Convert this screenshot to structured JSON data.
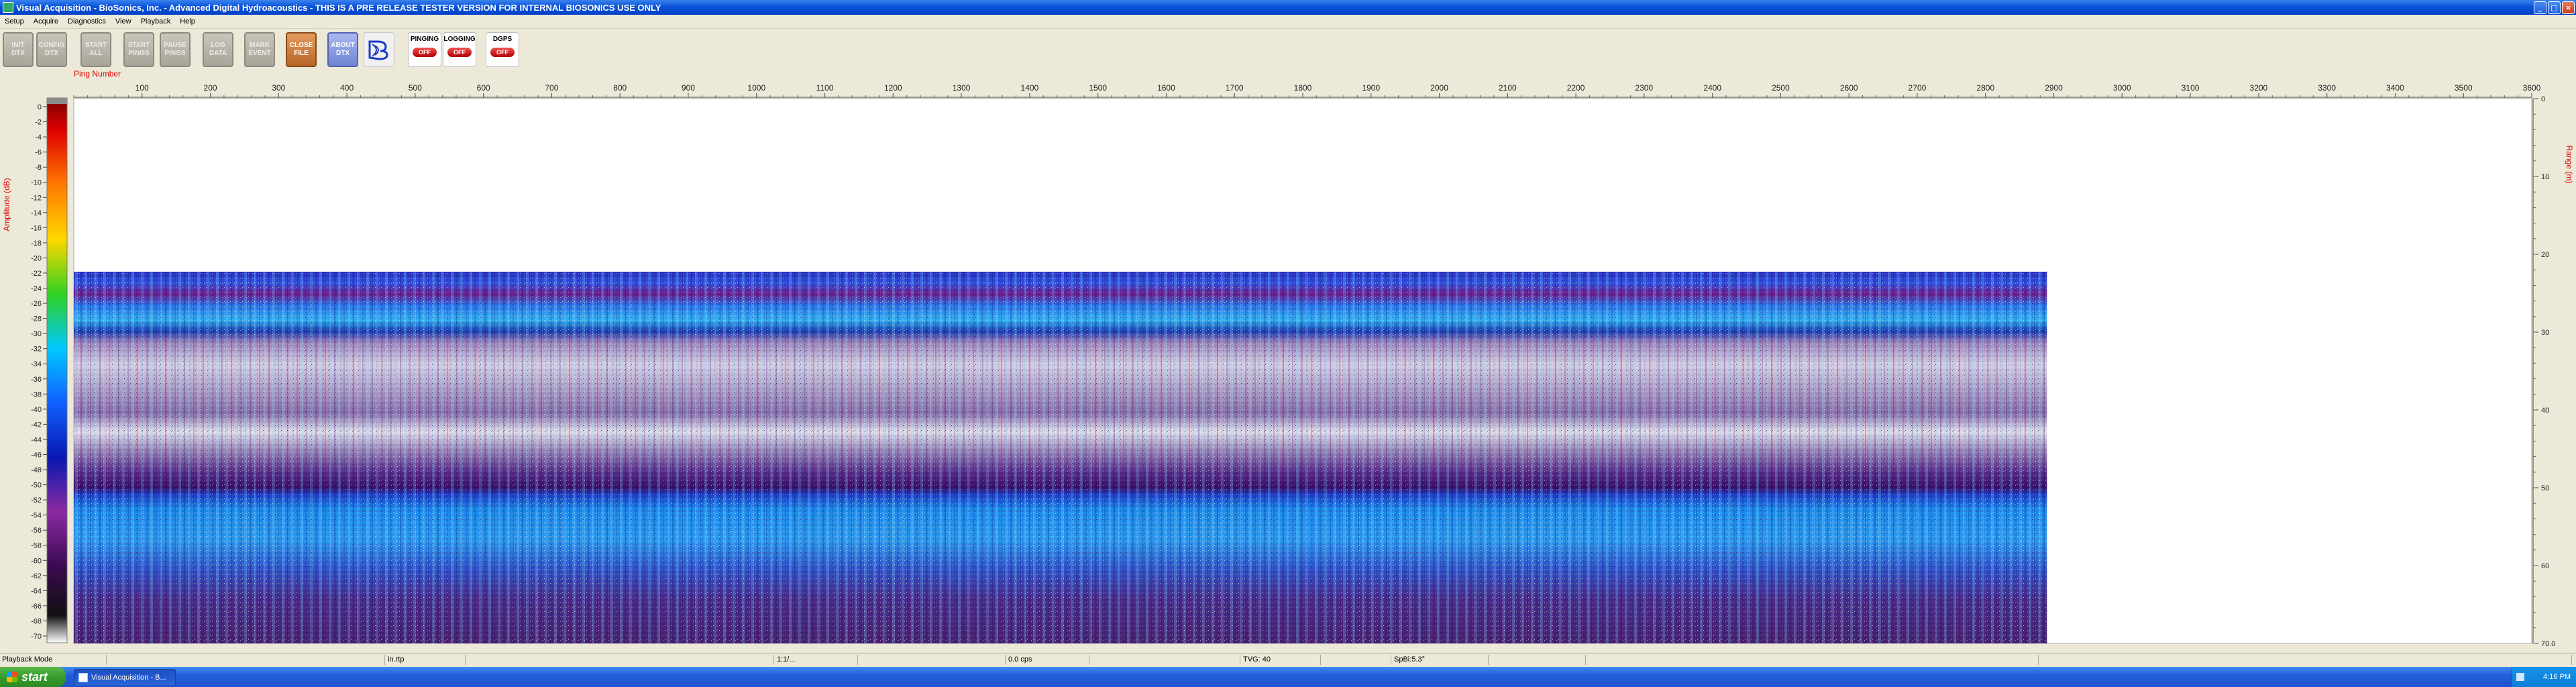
{
  "window": {
    "title": "Visual Acquisition  -  BioSonics, Inc.  -  Advanced Digital Hydroacoustics  -  THIS IS A PRE RELEASE TESTER VERSION FOR INTERNAL BIOSONICS USE ONLY",
    "minimize": "_",
    "maximize": "□",
    "close": "×"
  },
  "menu": [
    "Setup",
    "Acquire",
    "Diagnostics",
    "View",
    "Playback",
    "Help"
  ],
  "toolbar": {
    "buttons": [
      {
        "label": "INIT\nDTX",
        "style": "gray"
      },
      {
        "label": "CONFIG\nDTX",
        "style": "gray"
      },
      {
        "label": "START\nALL",
        "style": "gray"
      },
      {
        "label": "START\nPINGS",
        "style": "gray"
      },
      {
        "label": "PAUSE\nPINGS",
        "style": "gray"
      },
      {
        "label": "LOG\nDATA",
        "style": "gray"
      },
      {
        "label": "MARK\nEVENT",
        "style": "gray"
      },
      {
        "label": "CLOSE\nFILE",
        "style": "brown"
      },
      {
        "label": "ABOUT\nDTX",
        "style": "blue"
      }
    ],
    "logo_icon": "biosonics-logo-icon",
    "pinging": {
      "label": "PINGING",
      "state": "OFF"
    },
    "logging": {
      "label": "LOGGING",
      "state": "OFF"
    },
    "dgps": {
      "label": "DGPS",
      "state": "OFF"
    }
  },
  "plot": {
    "x_axis_label": "Ping Number",
    "x_ticks": [
      100,
      200,
      300,
      400,
      500,
      600,
      700,
      800,
      900,
      1000,
      1100,
      1200,
      1300,
      1400,
      1500,
      1600,
      1700,
      1800,
      1900,
      2000,
      2100,
      2200,
      2300,
      2400,
      2500,
      2600,
      2700,
      2800,
      2900,
      3000,
      3100,
      3200,
      3300,
      3400,
      3500,
      3600
    ],
    "x_range": [
      0,
      3600
    ],
    "data_extent_pings": 2890,
    "left_axis_label": "Amplitude (dB)",
    "amplitude_ticks": [
      0,
      -2,
      -4,
      -6,
      -8,
      -10,
      -12,
      -14,
      -16,
      -18,
      -20,
      -22,
      -24,
      -26,
      -28,
      -30,
      -32,
      -34,
      -36,
      -38,
      -40,
      -42,
      -44,
      -46,
      -48,
      -50,
      -52,
      -54,
      -56,
      -58,
      -60,
      -62,
      -64,
      -66,
      -68,
      -70
    ],
    "right_axis_label": "Range (m)",
    "range_ticks": [
      0,
      10,
      20,
      30,
      40,
      50,
      60,
      70.0
    ],
    "range_max_label": "70.0",
    "colors": {
      "label_red": "#e00000",
      "plot_bg": "#ffffff",
      "surface_blue": "#1840d8",
      "midwater_purple": "#4a1a7a",
      "bottom_cyan": "#20b0ff"
    }
  },
  "status": [
    "Playback Mode",
    "",
    "in.rtp",
    "",
    "1:1/...",
    "",
    "0.0 cps",
    "",
    "TVG: 40",
    "",
    "SpBi:5.3°",
    "",
    "",
    ""
  ],
  "taskbar": {
    "start_label": "start",
    "task_label": "Visual Acquisition - B...",
    "clock": "4:16 PM"
  }
}
